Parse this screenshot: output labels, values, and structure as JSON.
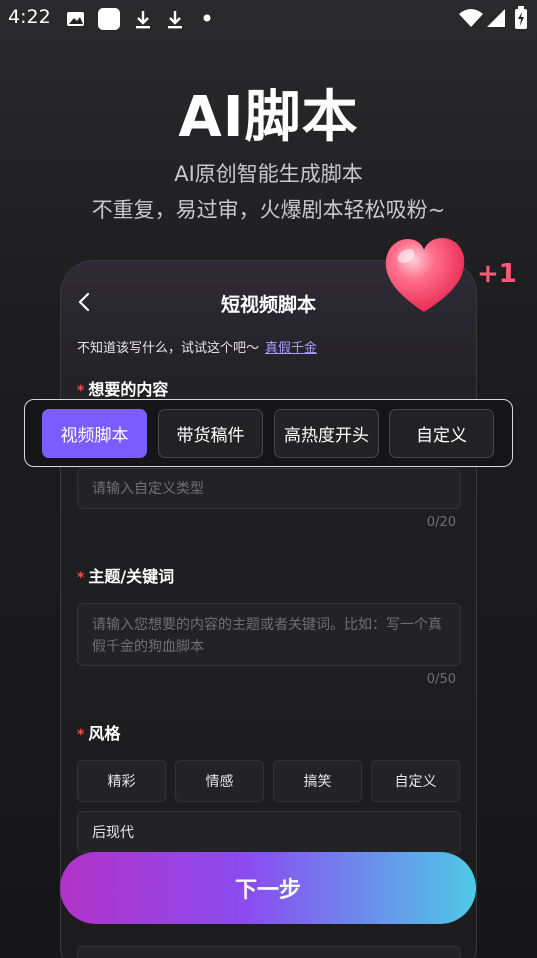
{
  "status_bar": {
    "time": "4:22",
    "icons": [
      "image-icon",
      "square-icon",
      "download-icon",
      "download-icon",
      "dot-icon",
      "wifi-icon",
      "signal-icon",
      "battery-icon"
    ]
  },
  "hero": {
    "title": "AI脚本",
    "subtitle_1": "AI原创智能生成脚本",
    "subtitle_2": "不重复，易过审，火爆剧本轻松吸粉~"
  },
  "card": {
    "title": "短视频脚本",
    "tip_text": "不知道该写什么，试试这个吧～",
    "tip_link": "真假千金"
  },
  "content_section": {
    "label": "想要的内容",
    "required_mark": "*",
    "types": [
      "视频脚本",
      "带货稿件",
      "高热度开头",
      "自定义"
    ],
    "active_type": "视频脚本",
    "custom_placeholder": "请输入自定义类型",
    "custom_counter": "0/20"
  },
  "topic_section": {
    "label": "主题/关键词",
    "required_mark": "*",
    "placeholder": "请输入您想要的内容的主题或者关键词。比如：写一个真假千金的狗血脚本",
    "counter": "0/50"
  },
  "style_section": {
    "label": "风格",
    "required_mark": "*",
    "options": [
      "精彩",
      "情感",
      "搞笑",
      "自定义"
    ],
    "value": "后现代"
  },
  "next_button": "下一步",
  "badge": {
    "plus_one": "+1"
  },
  "colors": {
    "accent": "#7a5cff",
    "link": "#a99bff",
    "required": "#ff4a4a",
    "gradient_start": "#b233c9",
    "gradient_end": "#4fc9e6"
  }
}
